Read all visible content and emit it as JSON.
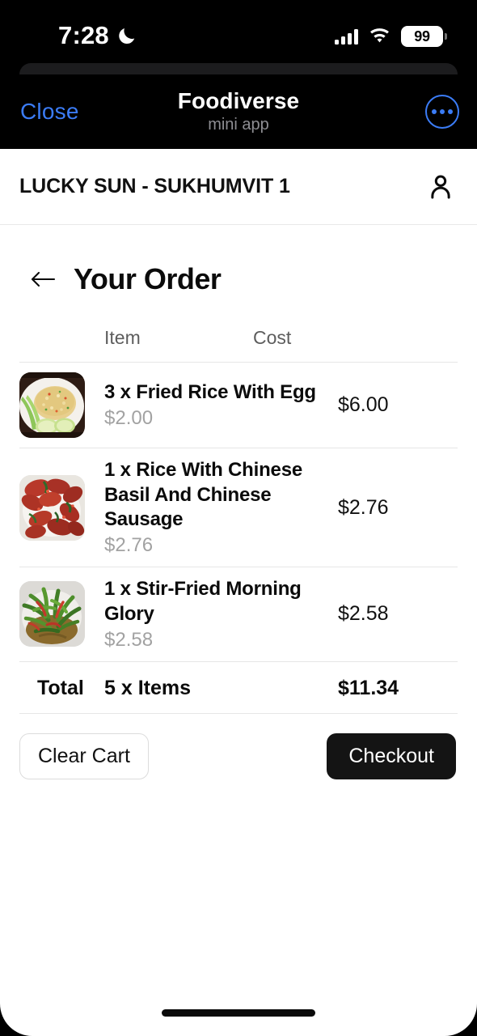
{
  "status_bar": {
    "time": "7:28",
    "dnd_icon": "crescent-moon-icon",
    "signal_icon": "cellular-signal-icon",
    "wifi_icon": "wifi-icon",
    "battery_level": "99"
  },
  "miniapp_bar": {
    "close_label": "Close",
    "title": "Foodiverse",
    "subtitle": "mini app",
    "more_icon": "more-options-icon",
    "accent_color": "#3b7cf6"
  },
  "store_header": {
    "name": "LUCKY SUN - SUKHUMVIT 1",
    "account_icon": "person-icon"
  },
  "order": {
    "back_icon": "back-arrow-icon",
    "title": "Your Order",
    "columns": {
      "item": "Item",
      "cost": "Cost"
    },
    "items": [
      {
        "name": "3 x Fried Rice With Egg",
        "unit_price": "$2.00",
        "cost": "$6.00",
        "thumb": "fried-rice-with-egg-photo"
      },
      {
        "name": "1 x Rice With Chinese Basil And Chinese Sausage",
        "unit_price": "$2.76",
        "cost": "$2.76",
        "thumb": "rice-with-chinese-basil-sausage-photo"
      },
      {
        "name": "1 x Stir-Fried Morning Glory",
        "unit_price": "$2.58",
        "cost": "$2.58",
        "thumb": "stir-fried-morning-glory-photo"
      }
    ],
    "total": {
      "label": "Total",
      "item_count": "5 x Items",
      "amount": "$11.34"
    }
  },
  "actions": {
    "clear_cart": "Clear Cart",
    "checkout": "Checkout",
    "checkout_bg": "#141414"
  }
}
